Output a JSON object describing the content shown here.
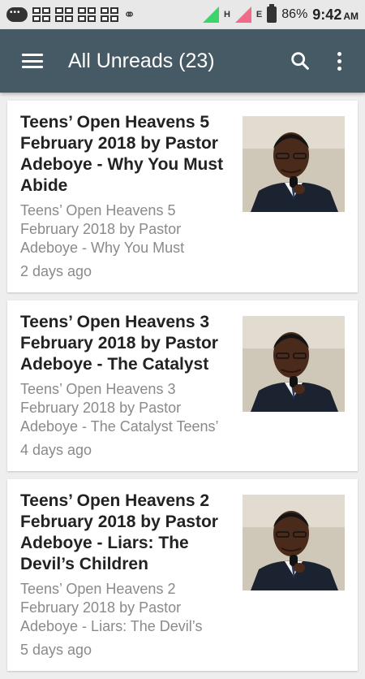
{
  "status_bar": {
    "battery_percent": "86%",
    "time": "9:42",
    "ampm": "AM",
    "network_label_h": "H",
    "network_label_e": "E",
    "icons": [
      "chat-bubble-icon",
      "bbm-icon",
      "bbm-icon",
      "bbm-icon",
      "bbm-icon",
      "flame-icon",
      "signal-icon",
      "signal-icon",
      "battery-icon"
    ]
  },
  "app_bar": {
    "title": "All Unreads (23)",
    "background": "#455a64",
    "icons": [
      "menu-icon",
      "search-icon",
      "more-vert-icon"
    ]
  },
  "articles": [
    {
      "title": "Teens’ Open Heavens 5 February 2018 by Pastor Adeboye - Why You Must Abide",
      "snippet": "Teens’ Open Heavens 5 February 2018 by Pastor Adeboye - Why You Must",
      "time": "2 days ago"
    },
    {
      "title": "Teens’ Open Heavens 3 February 2018 by Pastor Adeboye - The Catalyst",
      "snippet": "Teens’ Open Heavens 3 February 2018 by Pastor Adeboye - The Catalyst Teens’",
      "time": "4 days ago"
    },
    {
      "title": "Teens’ Open Heavens 2 February 2018 by Pastor Adeboye - Liars: The Devil’s Children",
      "snippet": "Teens’ Open Heavens 2 February 2018 by Pastor Adeboye - Liars: The Devil’s",
      "time": "5 days ago"
    }
  ]
}
